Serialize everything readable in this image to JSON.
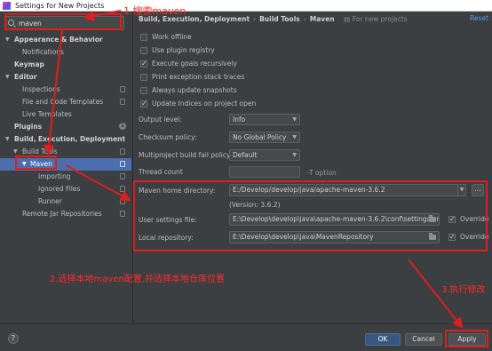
{
  "window": {
    "title": "Settings for New Projects"
  },
  "search": {
    "value": "maven"
  },
  "sidebar": {
    "items": [
      {
        "label": "Appearance & Behavior",
        "level": 0,
        "expanded": true,
        "bold": true
      },
      {
        "label": "Notifications",
        "level": 1
      },
      {
        "label": "Keymap",
        "level": 0,
        "bold": true
      },
      {
        "label": "Editor",
        "level": 0,
        "expanded": true,
        "bold": true
      },
      {
        "label": "Inspections",
        "level": 1,
        "page_icon": true
      },
      {
        "label": "File and Code Templates",
        "level": 1,
        "page_icon": true
      },
      {
        "label": "Live Templates",
        "level": 1
      },
      {
        "label": "Plugins",
        "level": 0,
        "bold": true,
        "badge": "1"
      },
      {
        "label": "Build, Execution, Deployment",
        "level": 0,
        "expanded": true,
        "bold": true
      },
      {
        "label": "Build Tools",
        "level": 1,
        "expanded": true,
        "page_icon": true
      },
      {
        "label": "Maven",
        "level": 2,
        "expanded": true,
        "selected": true,
        "page_icon": true
      },
      {
        "label": "Importing",
        "level": 3,
        "page_icon": true
      },
      {
        "label": "Ignored Files",
        "level": 3,
        "page_icon": true
      },
      {
        "label": "Runner",
        "level": 3,
        "page_icon": true
      },
      {
        "label": "Remote Jar Repositories",
        "level": 1,
        "page_icon": true
      }
    ]
  },
  "breadcrumb": {
    "parts": [
      "Build, Execution, Deployment",
      "Build Tools",
      "Maven"
    ],
    "separator": "›",
    "note": "For new projects",
    "reset": "Reset"
  },
  "checkboxes": [
    {
      "label": "Work offline",
      "checked": false
    },
    {
      "label": "Use plugin registry",
      "checked": false
    },
    {
      "label": "Execute goals recursively",
      "checked": true
    },
    {
      "label": "Print exception stack traces",
      "checked": false
    },
    {
      "label": "Always update snapshots",
      "checked": false
    },
    {
      "label": "Update Indices on project open",
      "checked": true
    }
  ],
  "settings": {
    "output_level": {
      "label": "Output level:",
      "value": "Info"
    },
    "checksum_policy": {
      "label": "Checksum policy:",
      "value": "No Global Policy"
    },
    "multiproject_fail_policy": {
      "label": "Multiproject build fail policy:",
      "value": "Default"
    },
    "thread_count": {
      "label": "Thread count",
      "value": "",
      "hint": "-T option"
    },
    "maven_home": {
      "label": "Maven home directory:",
      "value": "E:/Develop/develop/java/apache-maven-3.6.2",
      "version": "(Version: 3.6.2)"
    },
    "user_settings": {
      "label": "User settings file:",
      "value": "E:\\Develop\\develop\\java\\apache-maven-3.6.2\\conf\\settings.xml",
      "override_label": "Override",
      "override": true
    },
    "local_repo": {
      "label": "Local repository:",
      "value": "E:\\Develop\\develop\\java\\MavenRepository",
      "override_label": "Override",
      "override": true
    }
  },
  "annotations": {
    "step1": "1.搜索maven",
    "step2": "2.选择本地maven配置,并选择本地仓库位置",
    "step3": "3.执行修改",
    "color": "#e11d1d"
  },
  "footer": {
    "help": "?",
    "ok": "OK",
    "cancel": "Cancel",
    "apply": "Apply"
  },
  "colors": {
    "background": "#3c3f41",
    "selection": "#4b6eaf",
    "link": "#589df6",
    "primary_button": "#365880"
  }
}
